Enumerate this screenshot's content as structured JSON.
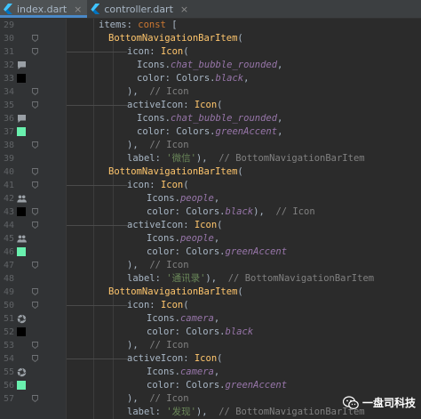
{
  "tabs": [
    {
      "label": "index.dart",
      "close": "×",
      "active": true
    },
    {
      "label": "controller.dart",
      "close": "×",
      "active": false
    }
  ],
  "gutter": {
    "line_numbers": [
      "29",
      "30",
      "31",
      "32",
      "33",
      "34",
      "35",
      "36",
      "37",
      "38",
      "39",
      "40",
      "41",
      "42",
      "43",
      "44",
      "45",
      "46",
      "47",
      "48",
      "49",
      "50",
      "51",
      "52",
      "53",
      "54",
      "55",
      "56",
      "57"
    ],
    "icons": {
      "32": "chat-bubble-icon",
      "33": "color-swatch-black",
      "36": "chat-bubble-icon",
      "37": "color-swatch-green-accent",
      "42": "people-icon",
      "43": "color-swatch-black",
      "45": "people-icon",
      "46": "color-swatch-green-accent",
      "51": "camera-icon",
      "52": "color-swatch-black",
      "55": "camera-icon",
      "56": "color-swatch-green-accent"
    },
    "swatch_colors": {
      "black": "#000000",
      "green_accent": "#69f0ae"
    }
  },
  "code": {
    "l29": {
      "a": "items: ",
      "b": "const",
      "c": " ["
    },
    "l30": {
      "a": "BottomNavigationBarItem",
      "b": "("
    },
    "l31": {
      "a": "icon: ",
      "b": "Icon",
      "c": "("
    },
    "l32": {
      "a": "Icons.",
      "b": "chat_bubble_rounded",
      "c": ","
    },
    "l33": {
      "a": "color: Colors.",
      "b": "black",
      "c": ","
    },
    "l34": {
      "a": "),",
      "b": "// Icon"
    },
    "l35": {
      "a": "activeIcon: ",
      "b": "Icon",
      "c": "("
    },
    "l36": {
      "a": "Icons.",
      "b": "chat_bubble_rounded",
      "c": ","
    },
    "l37": {
      "a": "color: Colors.",
      "b": "greenAccent",
      "c": ","
    },
    "l38": {
      "a": "),",
      "b": "// Icon"
    },
    "l39": {
      "a": "label: ",
      "b": "'微信'",
      "c": "),",
      "d": "// BottomNavigationBarItem"
    },
    "l40": {
      "a": "BottomNavigationBarItem",
      "b": "("
    },
    "l41": {
      "a": "icon: ",
      "b": "Icon",
      "c": "("
    },
    "l42": {
      "a": "Icons.",
      "b": "people",
      "c": ","
    },
    "l43": {
      "a": "color: Colors.",
      "b": "black",
      "c": "),",
      "d": "// Icon"
    },
    "l44": {
      "a": "activeIcon: ",
      "b": "Icon",
      "c": "("
    },
    "l45": {
      "a": "Icons.",
      "b": "people",
      "c": ","
    },
    "l46": {
      "a": "color: Colors.",
      "b": "greenAccent"
    },
    "l47": {
      "a": "),",
      "b": "// Icon"
    },
    "l48": {
      "a": "label: ",
      "b": "'通讯录'",
      "c": "),",
      "d": "// BottomNavigationBarItem"
    },
    "l49": {
      "a": "BottomNavigationBarItem",
      "b": "("
    },
    "l50": {
      "a": "icon: ",
      "b": "Icon",
      "c": "("
    },
    "l51": {
      "a": "Icons.",
      "b": "camera",
      "c": ","
    },
    "l52": {
      "a": "color: Colors.",
      "b": "black"
    },
    "l53": {
      "a": "),",
      "b": "// Icon"
    },
    "l54": {
      "a": "activeIcon: ",
      "b": "Icon",
      "c": "("
    },
    "l55": {
      "a": "Icons.",
      "b": "camera",
      "c": ","
    },
    "l56": {
      "a": "color: Colors.",
      "b": "greenAccent"
    },
    "l57": {
      "a": "),",
      "b": "// Icon"
    },
    "l58": {
      "a": "label: ",
      "b": "'发现'",
      "c": "),",
      "d": "// BottomNavigationBarItem"
    }
  },
  "watermark": {
    "text": "一盘司科技",
    "icon": "wechat-icon"
  },
  "colors": {
    "keyword": "#cc7832",
    "class": "#ffc66d",
    "field": "#9876aa",
    "string": "#6a8759",
    "comment": "#808080",
    "text": "#a9b7c6",
    "background": "#2b2b2b"
  }
}
